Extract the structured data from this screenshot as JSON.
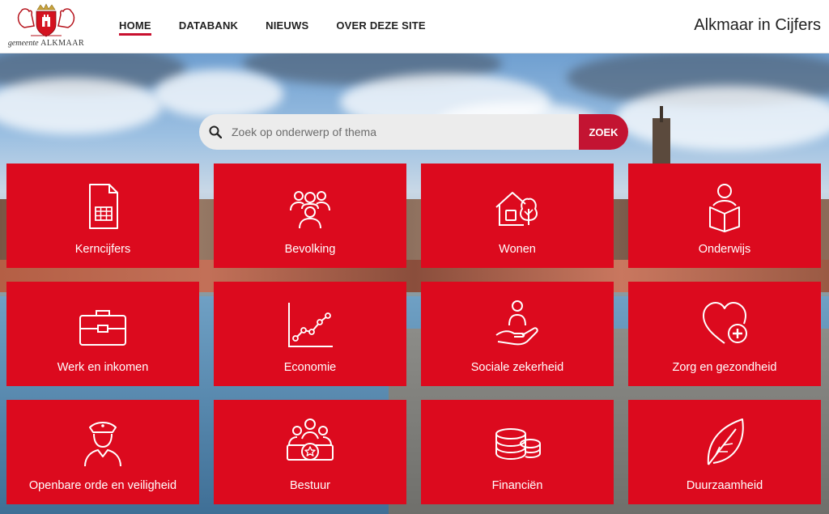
{
  "header": {
    "logo_text_small": "gemeente",
    "logo_text_big": "ALKMAAR",
    "site_title": "Alkmaar in Cijfers"
  },
  "nav": [
    {
      "label": "HOME",
      "active": true
    },
    {
      "label": "DATABANK",
      "active": false
    },
    {
      "label": "NIEUWS",
      "active": false
    },
    {
      "label": "OVER DEZE SITE",
      "active": false
    }
  ],
  "search": {
    "placeholder": "Zoek op onderwerp of thema",
    "button_label": "ZOEK"
  },
  "tiles": [
    {
      "label": "Kerncijfers",
      "icon": "document-table-icon"
    },
    {
      "label": "Bevolking",
      "icon": "people-group-icon"
    },
    {
      "label": "Wonen",
      "icon": "house-tree-icon"
    },
    {
      "label": "Onderwijs",
      "icon": "person-reading-icon"
    },
    {
      "label": "Werk en inkomen",
      "icon": "briefcase-icon"
    },
    {
      "label": "Economie",
      "icon": "line-chart-icon"
    },
    {
      "label": "Sociale zekerheid",
      "icon": "hand-person-icon"
    },
    {
      "label": "Zorg en gezondheid",
      "icon": "heart-plus-icon"
    },
    {
      "label": "Openbare orde en veiligheid",
      "icon": "police-officer-icon"
    },
    {
      "label": "Bestuur",
      "icon": "council-star-icon"
    },
    {
      "label": "Financiën",
      "icon": "coins-stack-icon"
    },
    {
      "label": "Duurzaamheid",
      "icon": "leaf-icon"
    }
  ],
  "colors": {
    "brand_red": "#dc0a1e",
    "search_button": "#c31432",
    "nav_underline": "#c8102e"
  }
}
